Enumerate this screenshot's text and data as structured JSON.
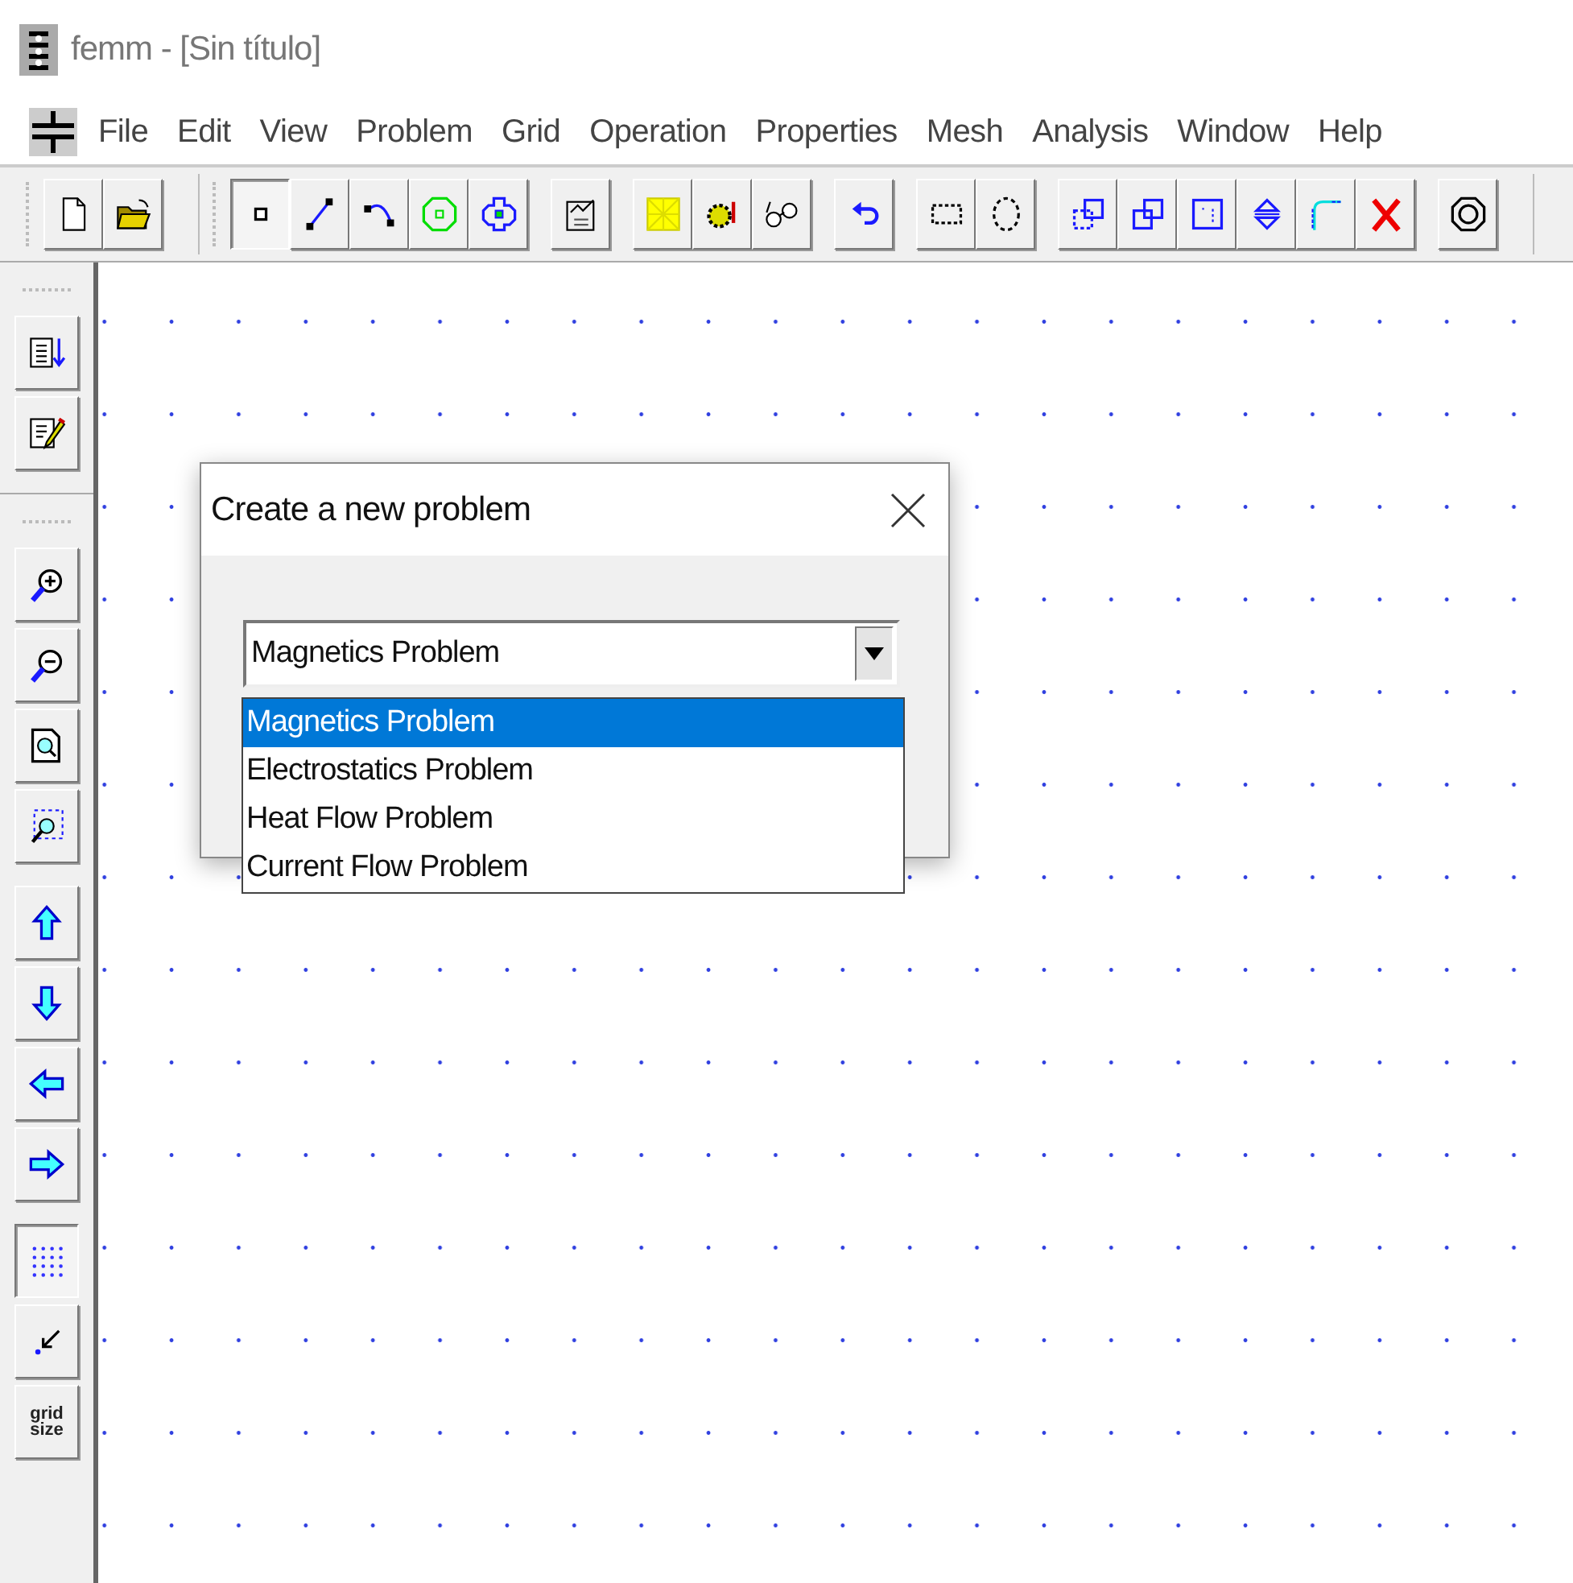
{
  "window": {
    "title": "femm - [Sin título]"
  },
  "menu": [
    "File",
    "Edit",
    "View",
    "Problem",
    "Grid",
    "Operation",
    "Properties",
    "Mesh",
    "Analysis",
    "Window",
    "Help"
  ],
  "toolbar": {
    "groups": [
      [
        {
          "pressed": false
        },
        {
          "pressed": false
        }
      ],
      [
        {
          "pressed": true
        },
        {
          "pressed": false
        },
        {
          "pressed": false
        },
        {
          "pressed": false
        },
        {
          "pressed": false
        }
      ],
      [
        {
          "pressed": false
        }
      ],
      [
        {
          "pressed": false
        },
        {
          "pressed": false
        },
        {
          "pressed": false
        }
      ],
      [
        {
          "pressed": false
        }
      ],
      [
        {
          "pressed": false
        },
        {
          "pressed": false
        }
      ],
      [
        {
          "pressed": false
        },
        {
          "pressed": false
        },
        {
          "pressed": false
        },
        {
          "pressed": false
        },
        {
          "pressed": false
        },
        {
          "pressed": false
        }
      ],
      [
        {
          "pressed": false
        }
      ]
    ]
  },
  "side_toolbar": {
    "groups": [
      [
        {
          "pressed": false
        },
        {
          "pressed": false
        }
      ],
      [
        {
          "pressed": false
        },
        {
          "pressed": false
        },
        {
          "pressed": false
        },
        {
          "pressed": false
        }
      ],
      [
        {
          "pressed": false
        },
        {
          "pressed": false
        },
        {
          "pressed": false
        },
        {
          "pressed": false
        }
      ],
      [
        {
          "pressed": true
        },
        {
          "pressed": false
        },
        {
          "pressed": false,
          "label": "grid size"
        }
      ]
    ]
  },
  "dialog": {
    "title": "Create a new problem",
    "combo": {
      "value": "Magnetics Problem",
      "expanded": true,
      "options": [
        {
          "label": "Magnetics Problem",
          "selected": true
        },
        {
          "label": "Electrostatics Problem",
          "selected": false
        },
        {
          "label": "Heat Flow Problem",
          "selected": false
        },
        {
          "label": "Current Flow Problem",
          "selected": false
        }
      ]
    }
  }
}
